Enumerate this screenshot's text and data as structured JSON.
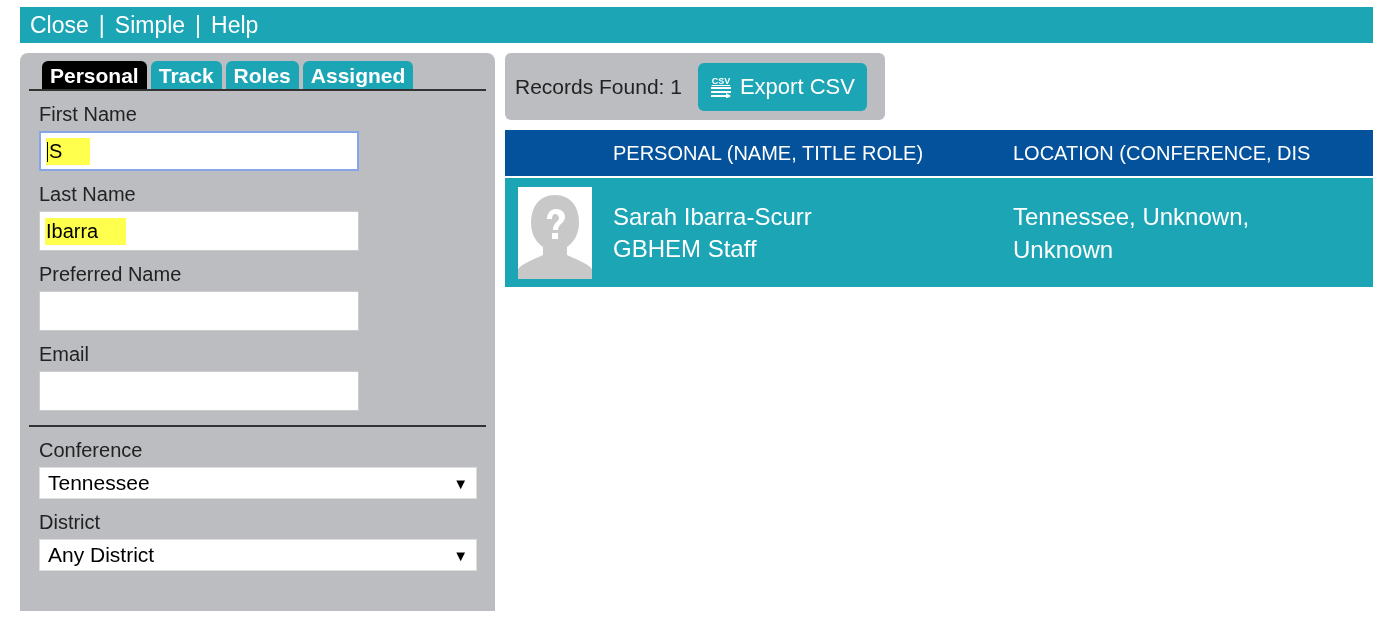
{
  "top_links": [
    {
      "label": "Close"
    },
    {
      "label": "Simple"
    },
    {
      "label": "Help"
    }
  ],
  "link_separator": "|",
  "tabs": [
    {
      "label": "Personal",
      "selected": true
    },
    {
      "label": "Track",
      "selected": false
    },
    {
      "label": "Roles",
      "selected": false
    },
    {
      "label": "Assigned",
      "selected": false
    }
  ],
  "text_fields": [
    {
      "label": "First Name",
      "value": "S",
      "focused": true,
      "highlighted": true
    },
    {
      "label": "Last Name",
      "value": "Ibarra",
      "focused": false,
      "highlighted": true
    },
    {
      "label": "Preferred Name",
      "focused": false
    },
    {
      "label": "Email",
      "focused": false
    }
  ],
  "dropdowns": [
    {
      "label": "Conference",
      "value": "Tennessee",
      "arrow": "▼"
    },
    {
      "label": "District",
      "value": "Any District",
      "arrow": "▼"
    }
  ],
  "results": {
    "count_label": "Records Found: 1",
    "export_button": {
      "label": "Export CSV",
      "icon_text": "CSV"
    }
  },
  "table": {
    "columns": [
      "PERSONAL (NAME, TITLE ROLE)",
      "LOCATION (CONFERENCE, DIS"
    ],
    "rows": [
      {
        "name": "Sarah Ibarra-Scurr",
        "role": "GBHEM Staff",
        "location": "Tennessee, Unknown, Unknown"
      }
    ]
  }
}
